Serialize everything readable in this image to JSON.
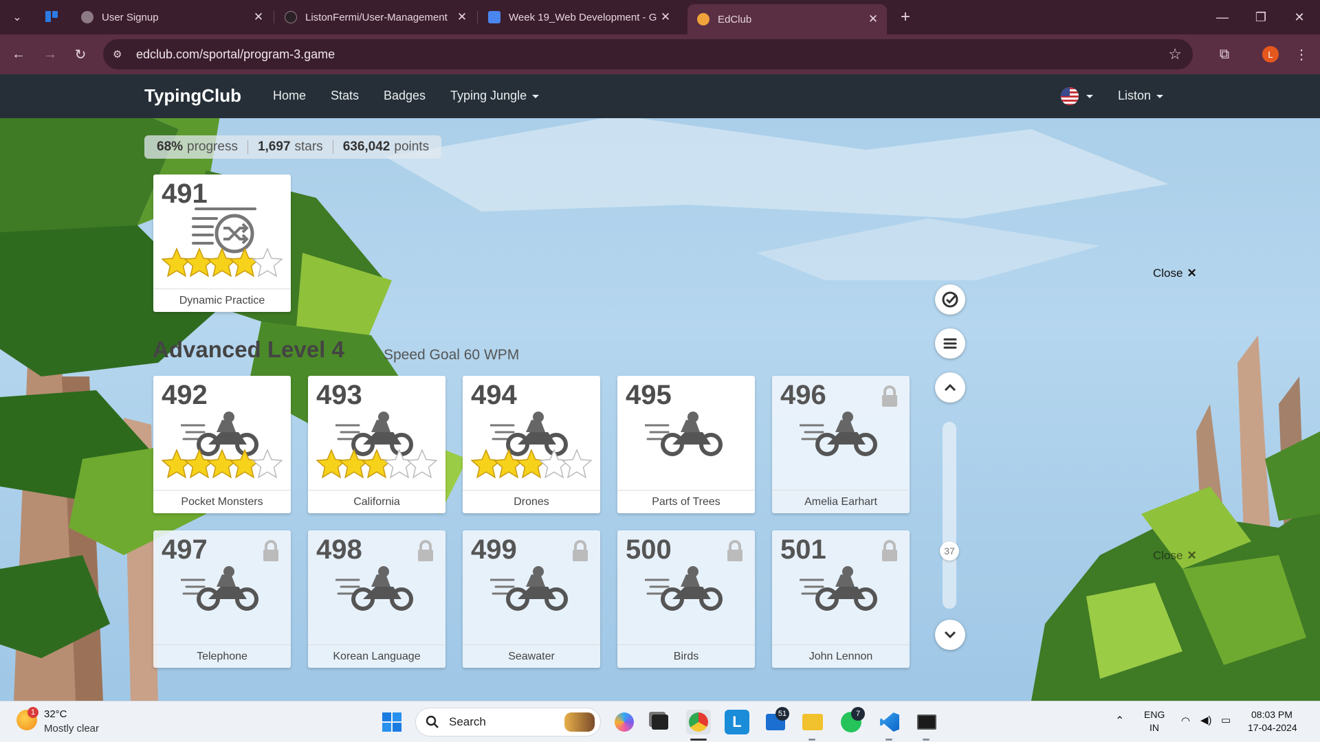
{
  "browser": {
    "tabs": [
      {
        "title": "User Signup"
      },
      {
        "title": "ListonFermi/User-Management"
      },
      {
        "title": "Week 19_Web Development - G"
      },
      {
        "title": "EdClub"
      }
    ],
    "url": "edclub.com/sportal/program-3.game",
    "profile_initial": "L"
  },
  "nav": {
    "brand": "TypingClub",
    "links": [
      "Home",
      "Stats",
      "Badges",
      "Typing Jungle"
    ],
    "user": "Liston"
  },
  "stats": {
    "progress_value": "68%",
    "progress_label": "progress",
    "stars_value": "1,697",
    "stars_label": "stars",
    "points_value": "636,042",
    "points_label": "points"
  },
  "top_lesson": {
    "number": "491",
    "name": "Dynamic Practice",
    "stars": 4,
    "icon": "shuffle-text-icon"
  },
  "level": {
    "title": "Advanced Level 4",
    "goal": "Speed Goal 60 WPM"
  },
  "lessons": [
    {
      "number": "492",
      "name": "Pocket Monsters",
      "stars": 4,
      "locked": false
    },
    {
      "number": "493",
      "name": "California",
      "stars": 3,
      "locked": false
    },
    {
      "number": "494",
      "name": "Drones",
      "stars": 3,
      "locked": false
    },
    {
      "number": "495",
      "name": "Parts of Trees",
      "stars": 0,
      "locked": false
    },
    {
      "number": "496",
      "name": "Amelia Earhart",
      "stars": 0,
      "locked": true
    },
    {
      "number": "497",
      "name": "Telephone",
      "stars": 0,
      "locked": true
    },
    {
      "number": "498",
      "name": "Korean Language",
      "stars": 0,
      "locked": true
    },
    {
      "number": "499",
      "name": "Seawater",
      "stars": 0,
      "locked": true
    },
    {
      "number": "500",
      "name": "Birds",
      "stars": 0,
      "locked": true
    },
    {
      "number": "501",
      "name": "John Lennon",
      "stars": 0,
      "locked": true
    }
  ],
  "scroll": {
    "page_indicator": "37"
  },
  "close_label": "Close",
  "close_glyph": "✕",
  "taskbar": {
    "weather_badge": "1",
    "temperature": "32°C",
    "condition": "Mostly clear",
    "search_label": "Search",
    "outlook_badge": "51",
    "whatsapp_badge": "7",
    "lang_top": "ENG",
    "lang_bottom": "IN",
    "time": "08:03 PM",
    "date": "17-04-2024"
  },
  "colors": {
    "brand_nav": "#262f38",
    "chrome_dark": "#3b1e2d",
    "chrome_mid": "#5a2f43",
    "star_gold": "#f7d21b"
  }
}
